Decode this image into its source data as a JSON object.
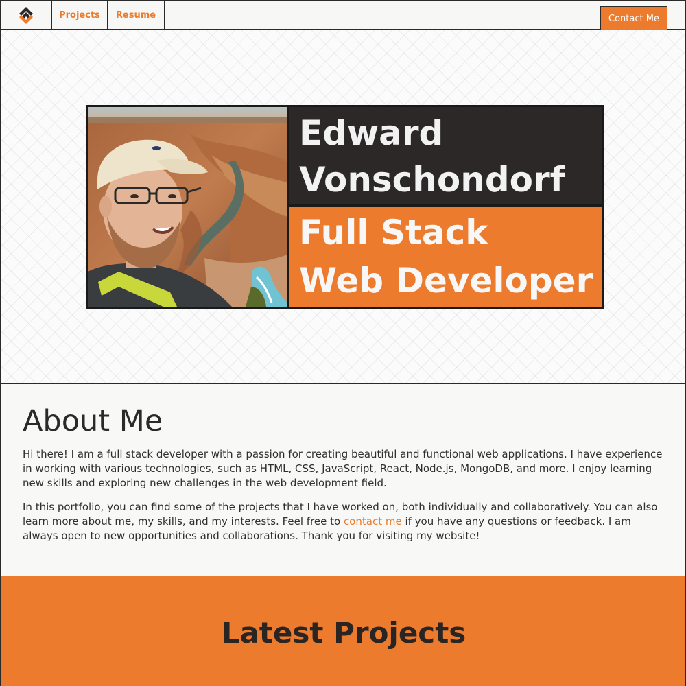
{
  "nav": {
    "logo_icon": "ev-logo-icon",
    "links": [
      {
        "label": "Projects"
      },
      {
        "label": "Resume"
      }
    ],
    "contact_label": "Contact Me"
  },
  "hero": {
    "photo_icon": "profile-photo",
    "name_lines": [
      "Edward",
      "Vonschondorf"
    ],
    "role_lines": [
      "Full Stack",
      "Web Developer"
    ]
  },
  "about": {
    "title": "About Me",
    "paragraph1": "Hi there! I am a full stack developer with a passion for creating beautiful and functional web applications. I have experience in working with various technologies, such as HTML, CSS, JavaScript, React, Node.js, MongoDB, and more. I enjoy learning new skills and exploring new challenges in the web development field.",
    "paragraph2_before": "In this portfolio, you can find some of the projects that I have worked on, both individually and collaboratively. You can also learn more about me, my skills, and my interests. Feel free to ",
    "paragraph2_link": "contact me",
    "paragraph2_after": " if you have any questions or feedback. I am always open to new opportunities and collaborations. Thank you for visiting my website!"
  },
  "projects": {
    "title": "Latest Projects"
  },
  "colors": {
    "accent": "#ec7b2d",
    "dark": "#2b2827",
    "light_text": "#f2f2f2"
  }
}
